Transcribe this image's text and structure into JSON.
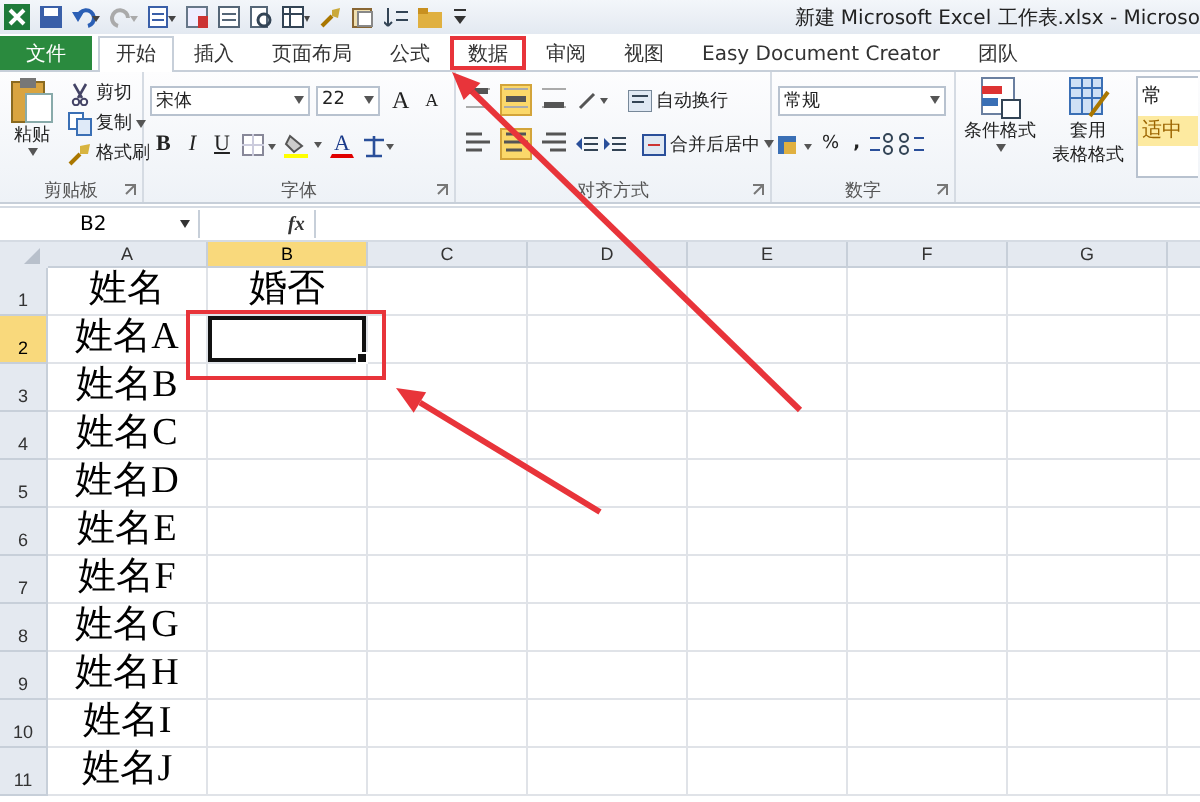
{
  "title_bar": {
    "title": "新建 Microsoft Excel 工作表.xlsx - Microso"
  },
  "tabs": [
    {
      "label": "文件",
      "kind": "file",
      "selected": false,
      "annotated": false
    },
    {
      "label": "开始",
      "kind": "tab",
      "selected": true,
      "annotated": false
    },
    {
      "label": "插入",
      "kind": "tab",
      "selected": false,
      "annotated": false
    },
    {
      "label": "页面布局",
      "kind": "tab",
      "selected": false,
      "annotated": false
    },
    {
      "label": "公式",
      "kind": "tab",
      "selected": false,
      "annotated": false
    },
    {
      "label": "数据",
      "kind": "tab",
      "selected": false,
      "annotated": true
    },
    {
      "label": "审阅",
      "kind": "tab",
      "selected": false,
      "annotated": false
    },
    {
      "label": "视图",
      "kind": "tab",
      "selected": false,
      "annotated": false
    },
    {
      "label": "Easy Document Creator",
      "kind": "tab",
      "selected": false,
      "annotated": false
    },
    {
      "label": "团队",
      "kind": "tab",
      "selected": false,
      "annotated": false
    }
  ],
  "ribbon": {
    "clipboard": {
      "label": "剪贴板",
      "paste": "粘贴",
      "items": [
        "剪切",
        "复制",
        "格式刷"
      ]
    },
    "font": {
      "label": "字体",
      "font_name": "宋体",
      "font_size": "22",
      "grow": "A",
      "shrink": "A",
      "styles": [
        "B",
        "I",
        "U"
      ],
      "color_letter": "A"
    },
    "alignment": {
      "label": "对齐方式",
      "vertical": [
        {
          "selected": false
        },
        {
          "selected": true
        },
        {
          "selected": false
        }
      ],
      "horizontal": [
        {
          "selected": false
        },
        {
          "selected": true
        },
        {
          "selected": false
        }
      ],
      "wrap": "自动换行",
      "merge": "合并后居中"
    },
    "number": {
      "label": "数字",
      "format": "常规",
      "percent": "%",
      "comma": ","
    },
    "styles": {
      "conditional": "条件格式",
      "table": [
        "套用",
        "表格格式"
      ],
      "gallery": [
        "常",
        "适中"
      ]
    }
  },
  "formula_bar": {
    "name_box": "B2",
    "function_label": "fx"
  },
  "sheet": {
    "columns": [
      {
        "label": "A",
        "selected": false
      },
      {
        "label": "B",
        "selected": true
      },
      {
        "label": "C",
        "selected": false
      },
      {
        "label": "D",
        "selected": false
      },
      {
        "label": "E",
        "selected": false
      },
      {
        "label": "F",
        "selected": false
      },
      {
        "label": "G",
        "selected": false
      }
    ],
    "active_cell_annotated": true,
    "rows": [
      {
        "label": "1",
        "selected": false,
        "cells": [
          "姓名",
          "婚否"
        ]
      },
      {
        "label": "2",
        "selected": true,
        "cells": [
          "姓名A"
        ]
      },
      {
        "label": "3",
        "selected": false,
        "cells": [
          "姓名B"
        ]
      },
      {
        "label": "4",
        "selected": false,
        "cells": [
          "姓名C"
        ]
      },
      {
        "label": "5",
        "selected": false,
        "cells": [
          "姓名D"
        ]
      },
      {
        "label": "6",
        "selected": false,
        "cells": [
          "姓名E"
        ]
      },
      {
        "label": "7",
        "selected": false,
        "cells": [
          "姓名F"
        ]
      },
      {
        "label": "8",
        "selected": false,
        "cells": [
          "姓名G"
        ]
      },
      {
        "label": "9",
        "selected": false,
        "cells": [
          "姓名H"
        ]
      },
      {
        "label": "10",
        "selected": false,
        "cells": [
          "姓名I"
        ]
      },
      {
        "label": "11",
        "selected": false,
        "cells": [
          "姓名J"
        ]
      }
    ]
  }
}
